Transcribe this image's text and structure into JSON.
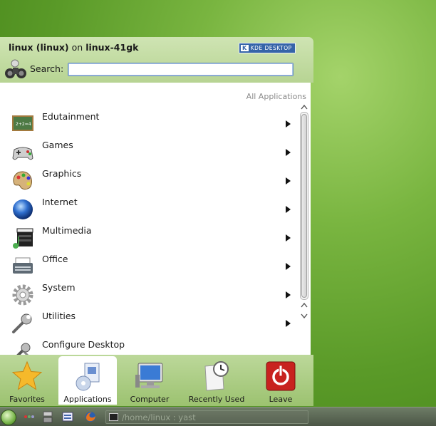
{
  "header": {
    "user": "linux (linux)",
    "on_word": "on",
    "host": "linux-41gk",
    "brand_k": "K",
    "brand_text": "KDE DESKTOP",
    "search_label": "Search:",
    "search_value": "",
    "search_placeholder": ""
  },
  "breadcrumb": "All Applications",
  "categories": [
    {
      "label": "Edutainment",
      "icon": "chalkboard-icon"
    },
    {
      "label": "Games",
      "icon": "gamepad-icon"
    },
    {
      "label": "Graphics",
      "icon": "palette-icon"
    },
    {
      "label": "Internet",
      "icon": "globe-icon"
    },
    {
      "label": "Multimedia",
      "icon": "clapperboard-icon"
    },
    {
      "label": "Office",
      "icon": "typewriter-icon"
    },
    {
      "label": "System",
      "icon": "gear-icon"
    },
    {
      "label": "Utilities",
      "icon": "wrench-icon"
    },
    {
      "label": "Configure Desktop",
      "icon": "tools-icon"
    }
  ],
  "tabs": [
    {
      "label": "Favorites",
      "icon": "star-icon",
      "active": false
    },
    {
      "label": "Applications",
      "icon": "applications-icon",
      "active": true
    },
    {
      "label": "Computer",
      "icon": "monitor-icon",
      "active": false
    },
    {
      "label": "Recently Used",
      "icon": "clock-document-icon",
      "active": false
    },
    {
      "label": "Leave",
      "icon": "power-icon",
      "active": false
    }
  ],
  "taskbar": {
    "window_title": "/home/linux : yast"
  },
  "colors": {
    "desktop_green": "#5a9a28",
    "menu_header": "#c3dca3",
    "leave_red": "#c8221f",
    "kde_blue": "#3564a8"
  }
}
